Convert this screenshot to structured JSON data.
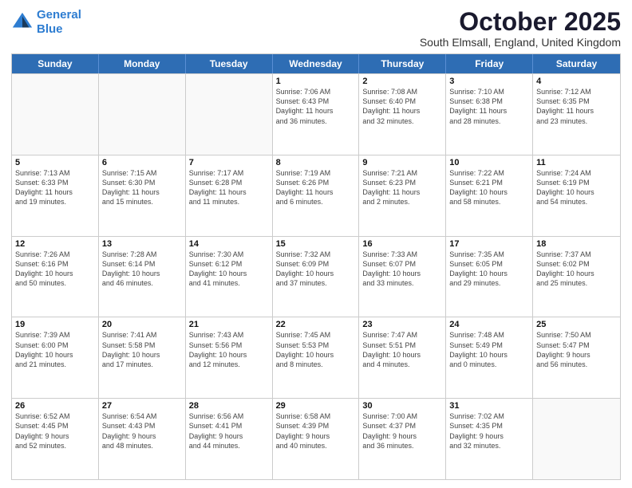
{
  "logo": {
    "line1": "General",
    "line2": "Blue"
  },
  "title": "October 2025",
  "subtitle": "South Elmsall, England, United Kingdom",
  "weekdays": [
    "Sunday",
    "Monday",
    "Tuesday",
    "Wednesday",
    "Thursday",
    "Friday",
    "Saturday"
  ],
  "weeks": [
    [
      {
        "day": "",
        "info": ""
      },
      {
        "day": "",
        "info": ""
      },
      {
        "day": "",
        "info": ""
      },
      {
        "day": "1",
        "info": "Sunrise: 7:06 AM\nSunset: 6:43 PM\nDaylight: 11 hours\nand 36 minutes."
      },
      {
        "day": "2",
        "info": "Sunrise: 7:08 AM\nSunset: 6:40 PM\nDaylight: 11 hours\nand 32 minutes."
      },
      {
        "day": "3",
        "info": "Sunrise: 7:10 AM\nSunset: 6:38 PM\nDaylight: 11 hours\nand 28 minutes."
      },
      {
        "day": "4",
        "info": "Sunrise: 7:12 AM\nSunset: 6:35 PM\nDaylight: 11 hours\nand 23 minutes."
      }
    ],
    [
      {
        "day": "5",
        "info": "Sunrise: 7:13 AM\nSunset: 6:33 PM\nDaylight: 11 hours\nand 19 minutes."
      },
      {
        "day": "6",
        "info": "Sunrise: 7:15 AM\nSunset: 6:30 PM\nDaylight: 11 hours\nand 15 minutes."
      },
      {
        "day": "7",
        "info": "Sunrise: 7:17 AM\nSunset: 6:28 PM\nDaylight: 11 hours\nand 11 minutes."
      },
      {
        "day": "8",
        "info": "Sunrise: 7:19 AM\nSunset: 6:26 PM\nDaylight: 11 hours\nand 6 minutes."
      },
      {
        "day": "9",
        "info": "Sunrise: 7:21 AM\nSunset: 6:23 PM\nDaylight: 11 hours\nand 2 minutes."
      },
      {
        "day": "10",
        "info": "Sunrise: 7:22 AM\nSunset: 6:21 PM\nDaylight: 10 hours\nand 58 minutes."
      },
      {
        "day": "11",
        "info": "Sunrise: 7:24 AM\nSunset: 6:19 PM\nDaylight: 10 hours\nand 54 minutes."
      }
    ],
    [
      {
        "day": "12",
        "info": "Sunrise: 7:26 AM\nSunset: 6:16 PM\nDaylight: 10 hours\nand 50 minutes."
      },
      {
        "day": "13",
        "info": "Sunrise: 7:28 AM\nSunset: 6:14 PM\nDaylight: 10 hours\nand 46 minutes."
      },
      {
        "day": "14",
        "info": "Sunrise: 7:30 AM\nSunset: 6:12 PM\nDaylight: 10 hours\nand 41 minutes."
      },
      {
        "day": "15",
        "info": "Sunrise: 7:32 AM\nSunset: 6:09 PM\nDaylight: 10 hours\nand 37 minutes."
      },
      {
        "day": "16",
        "info": "Sunrise: 7:33 AM\nSunset: 6:07 PM\nDaylight: 10 hours\nand 33 minutes."
      },
      {
        "day": "17",
        "info": "Sunrise: 7:35 AM\nSunset: 6:05 PM\nDaylight: 10 hours\nand 29 minutes."
      },
      {
        "day": "18",
        "info": "Sunrise: 7:37 AM\nSunset: 6:02 PM\nDaylight: 10 hours\nand 25 minutes."
      }
    ],
    [
      {
        "day": "19",
        "info": "Sunrise: 7:39 AM\nSunset: 6:00 PM\nDaylight: 10 hours\nand 21 minutes."
      },
      {
        "day": "20",
        "info": "Sunrise: 7:41 AM\nSunset: 5:58 PM\nDaylight: 10 hours\nand 17 minutes."
      },
      {
        "day": "21",
        "info": "Sunrise: 7:43 AM\nSunset: 5:56 PM\nDaylight: 10 hours\nand 12 minutes."
      },
      {
        "day": "22",
        "info": "Sunrise: 7:45 AM\nSunset: 5:53 PM\nDaylight: 10 hours\nand 8 minutes."
      },
      {
        "day": "23",
        "info": "Sunrise: 7:47 AM\nSunset: 5:51 PM\nDaylight: 10 hours\nand 4 minutes."
      },
      {
        "day": "24",
        "info": "Sunrise: 7:48 AM\nSunset: 5:49 PM\nDaylight: 10 hours\nand 0 minutes."
      },
      {
        "day": "25",
        "info": "Sunrise: 7:50 AM\nSunset: 5:47 PM\nDaylight: 9 hours\nand 56 minutes."
      }
    ],
    [
      {
        "day": "26",
        "info": "Sunrise: 6:52 AM\nSunset: 4:45 PM\nDaylight: 9 hours\nand 52 minutes."
      },
      {
        "day": "27",
        "info": "Sunrise: 6:54 AM\nSunset: 4:43 PM\nDaylight: 9 hours\nand 48 minutes."
      },
      {
        "day": "28",
        "info": "Sunrise: 6:56 AM\nSunset: 4:41 PM\nDaylight: 9 hours\nand 44 minutes."
      },
      {
        "day": "29",
        "info": "Sunrise: 6:58 AM\nSunset: 4:39 PM\nDaylight: 9 hours\nand 40 minutes."
      },
      {
        "day": "30",
        "info": "Sunrise: 7:00 AM\nSunset: 4:37 PM\nDaylight: 9 hours\nand 36 minutes."
      },
      {
        "day": "31",
        "info": "Sunrise: 7:02 AM\nSunset: 4:35 PM\nDaylight: 9 hours\nand 32 minutes."
      },
      {
        "day": "",
        "info": ""
      }
    ]
  ]
}
